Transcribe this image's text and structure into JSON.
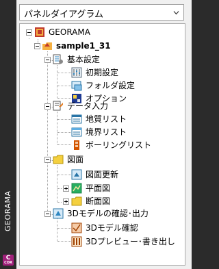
{
  "sidebar": {
    "title": "GEORAMA",
    "badge": "C",
    "badge_sub": "COR"
  },
  "dropdown": {
    "value": "パネルダイアグラム"
  },
  "tree": {
    "root": "GEORAMA",
    "project": "sample1_31",
    "basic": "基本設定",
    "initial": "初期設定",
    "folder": "フォルダ設定",
    "options": "オプション",
    "data_input": "データ入力",
    "geology": "地質リスト",
    "boundary": "境界リスト",
    "boring": "ボーリングリスト",
    "drawing": "図面",
    "update": "図面更新",
    "plan": "平面図",
    "section": "断面図",
    "model_group": "3Dモデルの確認･出力",
    "model_check": "3Dモデル確認",
    "preview": "3Dプレビュー･書き出し"
  }
}
